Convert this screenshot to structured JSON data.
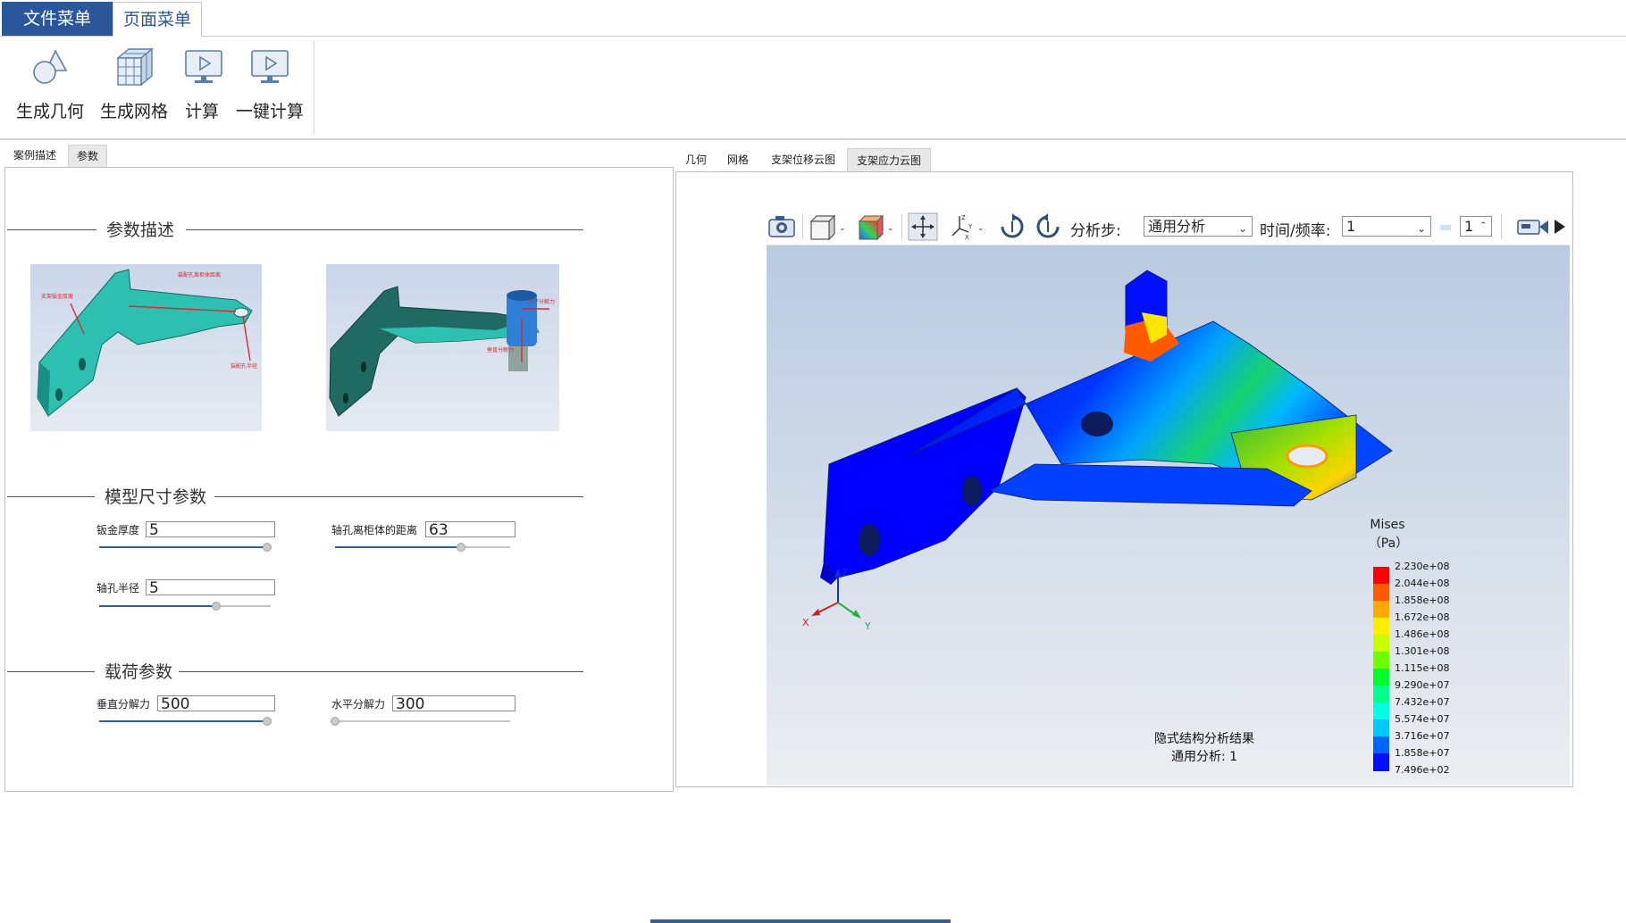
{
  "menu": {
    "file_label": "文件菜单",
    "page_label": "页面菜单"
  },
  "ribbon": {
    "buttons": [
      {
        "label": "生成几何",
        "icon": "geometry-shapes-icon"
      },
      {
        "label": "生成网格",
        "icon": "mesh-cube-icon"
      },
      {
        "label": "计算",
        "icon": "monitor-play-icon"
      },
      {
        "label": "一键计算",
        "icon": "monitor-play-icon"
      }
    ]
  },
  "left_tabs": [
    "案例描述",
    "参数"
  ],
  "left_active_tab": "参数",
  "sections": {
    "description": "参数描述",
    "model_dims": "模型尺寸参数",
    "loads": "载荷参数"
  },
  "thumb1_labels": {
    "a": "装配孔离柜体距离",
    "b": "支架钣金厚度",
    "c": "装配孔半径"
  },
  "thumb2_labels": {
    "a": "水平分解力",
    "b": "垂直分解力"
  },
  "params": {
    "sheet_thickness": {
      "label": "钣金厚度",
      "value": "5",
      "slider": 0.98
    },
    "hole_distance": {
      "label": "轴孔离柜体的距离",
      "value": "63",
      "slider": 0.72
    },
    "hole_radius": {
      "label": "轴孔半径",
      "value": "5",
      "slider": 0.68
    },
    "vertical_force": {
      "label": "垂直分解力",
      "value": "500",
      "slider": 0.98
    },
    "horizontal_force": {
      "label": "水平分解力",
      "value": "300",
      "slider": 0.0
    }
  },
  "right_tabs": [
    "几何",
    "网格",
    "支架位移云图",
    "支架应力云图"
  ],
  "right_active_tab": "支架应力云图",
  "toolbar": {
    "step_label": "分析步:",
    "step_value": "通用分析",
    "time_label": "时间/频率:",
    "time_value": "1",
    "frame_value": "1"
  },
  "legend": {
    "title": "Mises",
    "unit": "（Pa）",
    "values": [
      "2.230e+08",
      "2.044e+08",
      "1.858e+08",
      "1.672e+08",
      "1.486e+08",
      "1.301e+08",
      "1.115e+08",
      "9.290e+07",
      "7.432e+07",
      "5.574e+07",
      "3.716e+07",
      "1.858e+07",
      "7.496e+02"
    ],
    "colors": [
      "#ff0000",
      "#ff5a00",
      "#ffaa00",
      "#ffee00",
      "#c8ff00",
      "#6eff00",
      "#00ff2a",
      "#00ff8c",
      "#00ffe0",
      "#00c8ff",
      "#0064ff",
      "#0010ff"
    ]
  },
  "axes": {
    "x": "X",
    "y": "Y",
    "z": "Z"
  },
  "caption": {
    "line1": "隐式结构分析结果",
    "line2": "通用分析: 1"
  }
}
